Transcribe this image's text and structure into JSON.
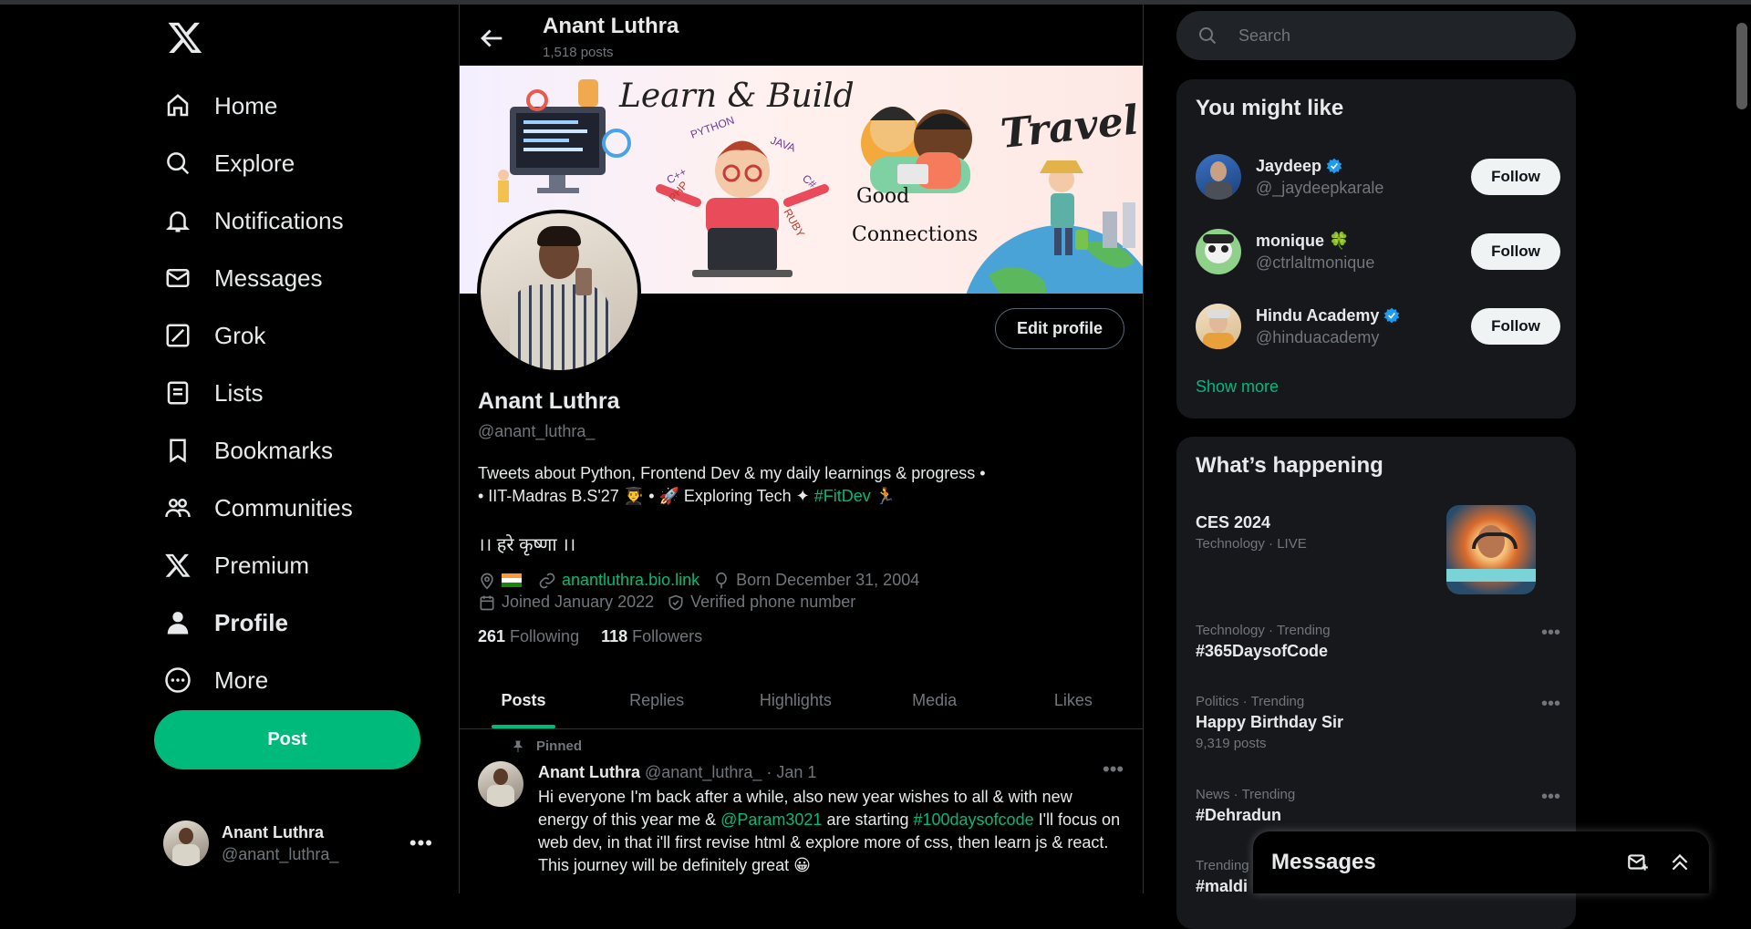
{
  "nav": {
    "items": [
      {
        "label": "Home",
        "icon": "home-icon"
      },
      {
        "label": "Explore",
        "icon": "search-icon"
      },
      {
        "label": "Notifications",
        "icon": "bell-icon"
      },
      {
        "label": "Messages",
        "icon": "mail-icon"
      },
      {
        "label": "Grok",
        "icon": "grok-icon"
      },
      {
        "label": "Lists",
        "icon": "list-icon"
      },
      {
        "label": "Bookmarks",
        "icon": "bookmark-icon"
      },
      {
        "label": "Communities",
        "icon": "people-icon"
      },
      {
        "label": "Premium",
        "icon": "x-logo-icon"
      },
      {
        "label": "Profile",
        "icon": "user-icon"
      },
      {
        "label": "More",
        "icon": "more-circle-icon"
      }
    ],
    "post_label": "Post",
    "account": {
      "name": "Anant Luthra",
      "handle": "@anant_luthra_"
    }
  },
  "header": {
    "name": "Anant Luthra",
    "post_count": "1,518 posts"
  },
  "banner": {
    "learn": "Learn & Build",
    "travel": "Travel",
    "good": "Good",
    "connections": "Connections",
    "python": "PYTHON",
    "java": "JAVA",
    "cpp": "C++",
    "csharp": "C#",
    "php": "PHP",
    "ruby": "RUBY"
  },
  "profile": {
    "edit_label": "Edit profile",
    "name": "Anant Luthra",
    "handle": "@anant_luthra_",
    "bio_line1": "Tweets about Python, Frontend Dev & my daily learnings & progress •",
    "bio_line2a": "• IIT-Madras B.S'27 👨‍🎓  • 🚀 Exploring Tech ✦ ",
    "bio_hashtag": "#FitDev",
    "bio_line2b": " 🏃",
    "bio_hindi": "।। हरे कृष्णा ।।",
    "website": "anantluthra.bio.link",
    "born": "Born December 31, 2004",
    "joined": "Joined January 2022",
    "verified_phone": "Verified phone number",
    "following_count": "261",
    "following_label": "Following",
    "followers_count": "118",
    "followers_label": "Followers"
  },
  "tabs": [
    "Posts",
    "Replies",
    "Highlights",
    "Media",
    "Likes"
  ],
  "pinned_tweet": {
    "pinned_label": "Pinned",
    "name": "Anant Luthra",
    "handle": "@anant_luthra_",
    "date": "· Jan 1",
    "t1": "Hi everyone I'm back after a while, also new year wishes to all & with new energy of this year me & ",
    "mention": "@Param3021",
    "t2": " are starting ",
    "hashtag": "#100daysofcode",
    "t3": " I'll focus on web dev, in that i'll first revise html & explore more of css, then learn  js & react. This journey will be definitely great 😀"
  },
  "search": {
    "placeholder": "Search"
  },
  "you_might_like": {
    "title": "You might like",
    "users": [
      {
        "name": "Jaydeep",
        "handle": "@_jaydeepkarale",
        "verified": true,
        "follow": "Follow"
      },
      {
        "name": "monique 🍀",
        "handle": "@ctrlaltmonique",
        "verified": false,
        "follow": "Follow"
      },
      {
        "name": "Hindu Academy",
        "handle": "@hinduacademy",
        "verified": true,
        "follow": "Follow"
      }
    ],
    "show_more": "Show more"
  },
  "whats_happening": {
    "title": "What’s happening",
    "trends": [
      {
        "category": "CES 2024",
        "meta": "Technology · LIVE"
      },
      {
        "category": "Technology · Trending",
        "title": "#365DaysofCode"
      },
      {
        "category": "Politics · Trending",
        "title": "Happy Birthday Sir",
        "count": "9,319 posts"
      },
      {
        "category": "News · Trending",
        "title": "#Dehradun"
      },
      {
        "category": "Trending",
        "title": "#maldi"
      }
    ]
  },
  "messages_drawer": {
    "title": "Messages"
  },
  "colors": {
    "accent": "#00ba7c",
    "background": "#000000",
    "verified": "#1d9bf0"
  }
}
